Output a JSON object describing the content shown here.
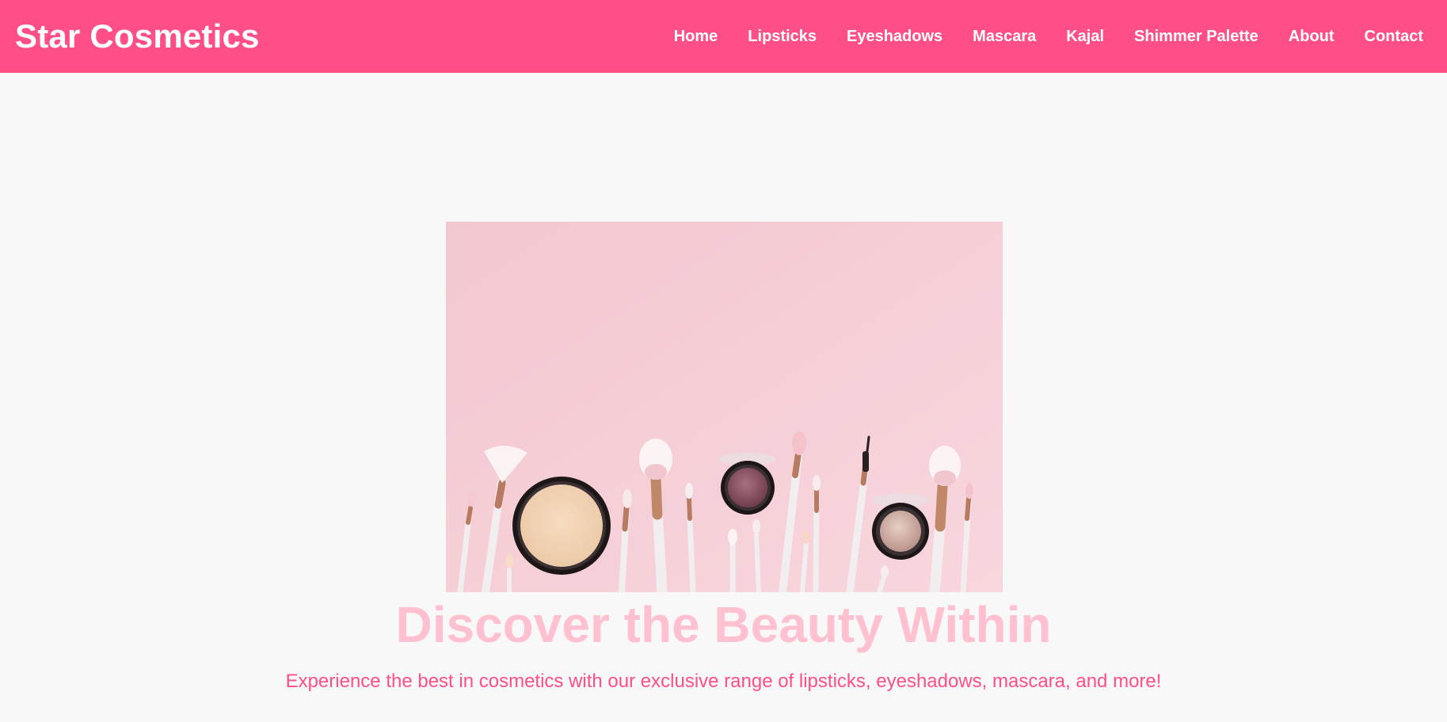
{
  "brand": {
    "name": "Star Cosmetics"
  },
  "nav": {
    "items": [
      {
        "label": "Home"
      },
      {
        "label": "Lipsticks"
      },
      {
        "label": "Eyeshadows"
      },
      {
        "label": "Mascara"
      },
      {
        "label": "Kajal"
      },
      {
        "label": "Shimmer Palette"
      },
      {
        "label": "About"
      },
      {
        "label": "Contact"
      }
    ]
  },
  "hero": {
    "image_icon": "cosmetics-flatlay-image",
    "title": "Discover the Beauty Within",
    "subtitle": "Experience the best in cosmetics with our exclusive range of lipsticks, eyeshadows, mascara, and more!"
  },
  "colors": {
    "navbar_bg": "#ff4f86",
    "page_bg": "#f8f8f8",
    "title_color": "#ffc0d0",
    "subtitle_color": "#ff4f86",
    "image_bg": "#f5cdd6"
  }
}
